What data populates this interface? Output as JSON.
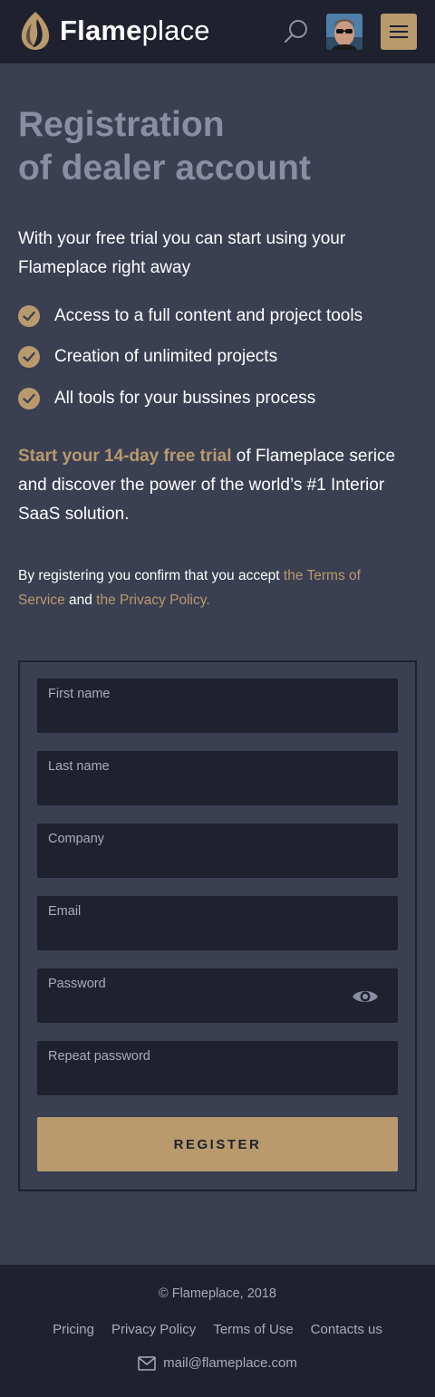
{
  "header": {
    "logo_bold": "Flame",
    "logo_light": "place",
    "search_icon": "search-icon",
    "menu_icon": "hamburger-menu-icon"
  },
  "hero": {
    "title_line1": "Registration",
    "title_line2": "of dealer account",
    "intro": "With your free trial you can start using your Flameplace right away",
    "features": [
      "Access to a full content and project tools",
      "Creation of unlimited projects",
      "All tools for your bussines process"
    ],
    "trial_accent": "Start your 14-day free trial",
    "trial_rest": " of Flameplace serice and discover the power of the world’s #1 Interior SaaS solution.",
    "consent_prefix": "By registering you confirm that you accept ",
    "terms_link": "the Terms of Service",
    "consent_and": " and ",
    "privacy_link": "the Privacy Policy."
  },
  "form": {
    "fields": [
      {
        "label": "First name",
        "value": ""
      },
      {
        "label": "Last name",
        "value": ""
      },
      {
        "label": "Company",
        "value": ""
      },
      {
        "label": "Email",
        "value": ""
      },
      {
        "label": "Password",
        "value": ""
      },
      {
        "label": "Repeat password",
        "value": ""
      }
    ],
    "register_label": "REGISTER"
  },
  "footer": {
    "copyright": "© Flameplace, 2018",
    "links": [
      "Pricing",
      "Privacy Policy",
      "Terms of Use",
      "Contacts us"
    ],
    "email": "mail@flameplace.com"
  },
  "colors": {
    "accent": "#b89a6c",
    "background": "#3b3f52",
    "dark": "#1f212f",
    "muted_title": "#8a8ea2"
  }
}
